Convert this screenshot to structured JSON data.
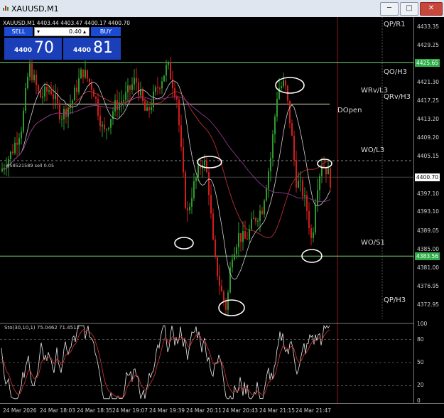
{
  "window": {
    "title": "XAUUSD,M1",
    "icons": [
      "minimize-icon",
      "maximize-icon",
      "close-icon"
    ]
  },
  "symbol_line": "XAUUSD,M1  4403.44 4403.47 4400.17 4400.70",
  "trade_panel": {
    "sell_label": "SELL",
    "buy_label": "BUY",
    "lot_value": "0.40",
    "sell_prefix": "4400",
    "sell_big": "70",
    "buy_prefix": "4400",
    "buy_big": "81"
  },
  "level_labels": {
    "qp_r1": "QP/R1",
    "qo_h3": "QO/H3",
    "wrv_l3": "WRv/L3",
    "qrv_h3": "QRv/H3",
    "dopen": "DOpen",
    "wo_l3": "WO/L3",
    "wo_s1": "WO/S1",
    "qp_h3": "QP/H3"
  },
  "order_line_label": "#58521589 sell 0.05",
  "price_axis": {
    "ticks": [
      "4433.35",
      "4429.25",
      "4425.65",
      "4421.30",
      "4417.25",
      "4413.20",
      "4409.20",
      "4405.15",
      "4400.70",
      "4397.10",
      "4393.10",
      "4389.05",
      "4385.00",
      "4383.56",
      "4381.00",
      "4376.95",
      "4372.95"
    ],
    "current_price": "4400.70",
    "green_box_1": "4425.65",
    "green_box_2": "4383.56"
  },
  "stochastic": {
    "label": "Sto(30,10,1) 75.0462 71.4512",
    "levels": [
      "100",
      "80",
      "50",
      "20",
      "0"
    ]
  },
  "time_axis": [
    "24 Mar 2026",
    "24 Mar 18:03",
    "24 Mar 18:35",
    "24 Mar 19:07",
    "24 Mar 19:39",
    "24 Mar 20:11",
    "24 Mar 20:43",
    "24 Mar 21:15",
    "24 Mar 21:47"
  ],
  "colors": {
    "bull": "#2e9a2e",
    "bear": "#d01d1d",
    "level_line": "#e0e0b8",
    "green_line": "#7bd47b",
    "ma_white": "#d0d0d0",
    "ma_red": "#b83030",
    "ma_purple": "#8a3a8a",
    "circle": "#ffffff"
  }
}
